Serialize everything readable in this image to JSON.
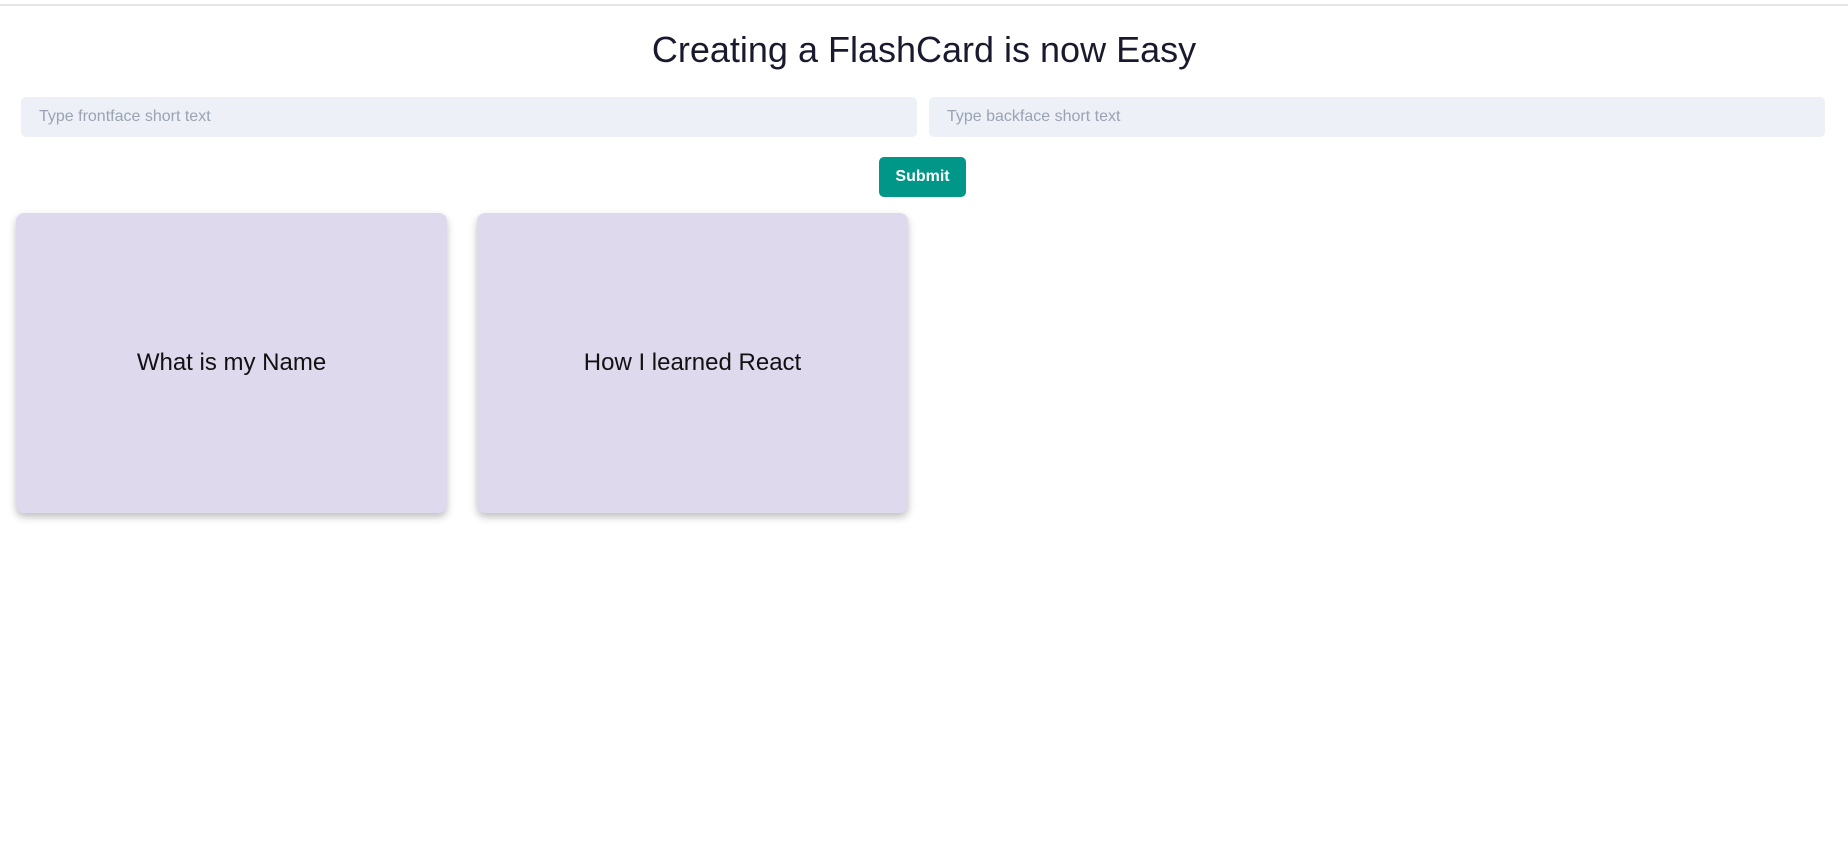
{
  "header": {
    "title": "Creating a FlashCard is now Easy"
  },
  "form": {
    "front_placeholder": "Type frontface short text",
    "front_value": "",
    "back_placeholder": "Type backface short text",
    "back_value": "",
    "submit_label": "Submit"
  },
  "cards": [
    {
      "front": "What is my Name"
    },
    {
      "front": "How I learned React"
    }
  ],
  "colors": {
    "accent": "#009688",
    "card_background": "#dfd9ee",
    "input_background": "#edf0f7"
  }
}
